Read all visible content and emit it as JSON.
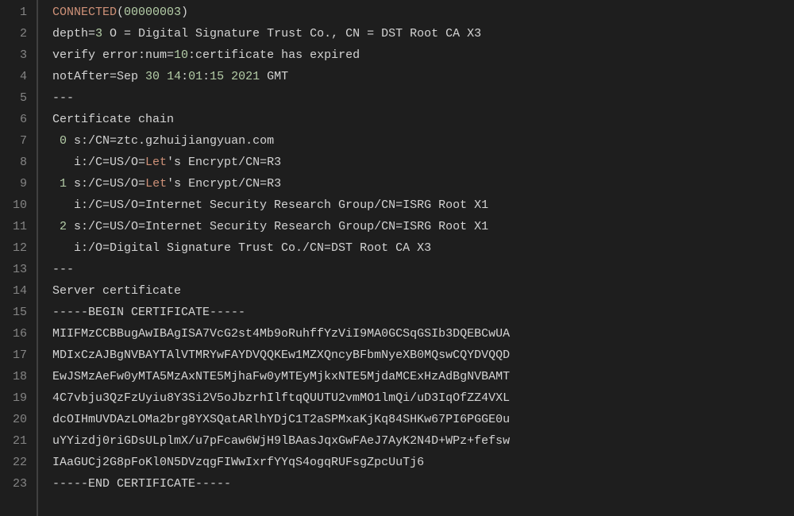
{
  "lines": [
    {
      "n": 1,
      "tokens": [
        {
          "c": "t-keyword",
          "t": "CONNECTED"
        },
        {
          "c": "t-default",
          "t": "("
        },
        {
          "c": "t-number",
          "t": "00000003"
        },
        {
          "c": "t-default",
          "t": ")"
        }
      ]
    },
    {
      "n": 2,
      "tokens": [
        {
          "c": "t-default",
          "t": "depth="
        },
        {
          "c": "t-number",
          "t": "3"
        },
        {
          "c": "t-default",
          "t": " O = Digital Signature Trust Co., CN = DST Root CA X3"
        }
      ]
    },
    {
      "n": 3,
      "tokens": [
        {
          "c": "t-default",
          "t": "verify error:num="
        },
        {
          "c": "t-number",
          "t": "10"
        },
        {
          "c": "t-default",
          "t": ":certificate has expired"
        }
      ]
    },
    {
      "n": 4,
      "tokens": [
        {
          "c": "t-default",
          "t": "notAfter=Sep "
        },
        {
          "c": "t-number",
          "t": "30"
        },
        {
          "c": "t-default",
          "t": " "
        },
        {
          "c": "t-number",
          "t": "14"
        },
        {
          "c": "t-default",
          "t": ":"
        },
        {
          "c": "t-number",
          "t": "01"
        },
        {
          "c": "t-default",
          "t": ":"
        },
        {
          "c": "t-number",
          "t": "15"
        },
        {
          "c": "t-default",
          "t": " "
        },
        {
          "c": "t-number",
          "t": "2021"
        },
        {
          "c": "t-default",
          "t": " GMT"
        }
      ]
    },
    {
      "n": 5,
      "tokens": [
        {
          "c": "t-default",
          "t": "---"
        }
      ]
    },
    {
      "n": 6,
      "tokens": [
        {
          "c": "t-default",
          "t": "Certificate chain"
        }
      ]
    },
    {
      "n": 7,
      "tokens": [
        {
          "c": "t-default",
          "t": " "
        },
        {
          "c": "t-number",
          "t": "0"
        },
        {
          "c": "t-default",
          "t": " s:/CN=ztc.gzhuijiangyuan.com"
        }
      ]
    },
    {
      "n": 8,
      "tokens": [
        {
          "c": "t-default",
          "t": "   i:/C=US/O="
        },
        {
          "c": "t-keyword",
          "t": "Let"
        },
        {
          "c": "t-default",
          "t": "'s Encrypt/CN=R3"
        }
      ]
    },
    {
      "n": 9,
      "tokens": [
        {
          "c": "t-default",
          "t": " "
        },
        {
          "c": "t-number",
          "t": "1"
        },
        {
          "c": "t-default",
          "t": " s:/C=US/O="
        },
        {
          "c": "t-keyword",
          "t": "Let"
        },
        {
          "c": "t-default",
          "t": "'s Encrypt/CN=R3"
        }
      ]
    },
    {
      "n": 10,
      "tokens": [
        {
          "c": "t-default",
          "t": "   i:/C=US/O=Internet Security Research Group/CN=ISRG Root X1"
        }
      ]
    },
    {
      "n": 11,
      "tokens": [
        {
          "c": "t-default",
          "t": " "
        },
        {
          "c": "t-number",
          "t": "2"
        },
        {
          "c": "t-default",
          "t": " s:/C=US/O=Internet Security Research Group/CN=ISRG Root X1"
        }
      ]
    },
    {
      "n": 12,
      "tokens": [
        {
          "c": "t-default",
          "t": "   i:/O=Digital Signature Trust Co./CN=DST Root CA X3"
        }
      ]
    },
    {
      "n": 13,
      "tokens": [
        {
          "c": "t-default",
          "t": "---"
        }
      ]
    },
    {
      "n": 14,
      "tokens": [
        {
          "c": "t-default",
          "t": "Server certificate"
        }
      ]
    },
    {
      "n": 15,
      "tokens": [
        {
          "c": "t-default",
          "t": "-----BEGIN CERTIFICATE-----"
        }
      ]
    },
    {
      "n": 16,
      "tokens": [
        {
          "c": "t-default",
          "t": "MIIFMzCCBBugAwIBAgISA7VcG2st4Mb9oRuhffYzViI9MA0GCSqGSIb3DQEBCwUA"
        }
      ]
    },
    {
      "n": 17,
      "tokens": [
        {
          "c": "t-default",
          "t": "MDIxCzAJBgNVBAYTAlVTMRYwFAYDVQQKEw1MZXQncyBFbmNyeXB0MQswCQYDVQQD"
        }
      ]
    },
    {
      "n": 18,
      "tokens": [
        {
          "c": "t-default",
          "t": "EwJSMzAeFw0yMTA5MzAxNTE5MjhaFw0yMTEyMjkxNTE5MjdaMCExHzAdBgNVBAMT"
        }
      ]
    },
    {
      "n": 19,
      "tokens": [
        {
          "c": "t-default",
          "t": "4C7vbju3QzFzUyiu8Y3Si2V5oJbzrhIlftqQUUTU2vmMO1lmQi"
        },
        {
          "c": "t-default",
          "t": "/"
        },
        {
          "c": "t-default",
          "t": "uD3IqOfZZ4VXL"
        }
      ]
    },
    {
      "n": 20,
      "tokens": [
        {
          "c": "t-default",
          "t": "dcOIHmUVDAzLOMa2brg8YXSQatARlhYDjC1T2aSPMxaKjKq84SHKw67PI6PGGE0u"
        }
      ]
    },
    {
      "n": 21,
      "tokens": [
        {
          "c": "t-default",
          "t": "uYYizdj0riGDsULplmX"
        },
        {
          "c": "t-default",
          "t": "/"
        },
        {
          "c": "t-default",
          "t": "u7pFcaw6WjH9lBAasJqxGwFAeJ7AyK2N4D"
        },
        {
          "c": "t-default",
          "t": "+"
        },
        {
          "c": "t-default",
          "t": "WPz"
        },
        {
          "c": "t-default",
          "t": "+"
        },
        {
          "c": "t-default",
          "t": "fefsw"
        }
      ]
    },
    {
      "n": 22,
      "tokens": [
        {
          "c": "t-default",
          "t": "IAaGUCj2G8pFoKl0N5DVzqgFIWwIxrfYYqS4ogqRUFsgZpcUuTj6"
        }
      ]
    },
    {
      "n": 23,
      "tokens": [
        {
          "c": "t-default",
          "t": "-----END CERTIFICATE-----"
        }
      ]
    }
  ]
}
